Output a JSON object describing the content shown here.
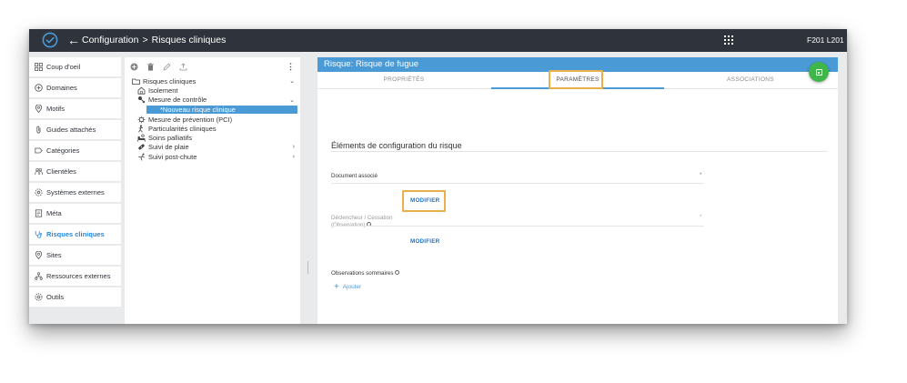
{
  "header": {
    "breadcrumb_root": "Configuration",
    "breadcrumb_separator": ">",
    "breadcrumb_current": "Risques cliniques",
    "user_code": "F201 L201"
  },
  "sidebar": {
    "items": [
      {
        "label": "Coup d'oeil",
        "icon": "dashboard-icon"
      },
      {
        "label": "Domaines",
        "icon": "domain-icon"
      },
      {
        "label": "Motifs",
        "icon": "pin-icon"
      },
      {
        "label": "Guides attachés",
        "icon": "attachment-icon"
      },
      {
        "label": "Catégories",
        "icon": "tag-icon"
      },
      {
        "label": "Clientèles",
        "icon": "people-icon"
      },
      {
        "label": "Systèmes externes",
        "icon": "settings-icon"
      },
      {
        "label": "Méta",
        "icon": "document-icon"
      },
      {
        "label": "Risques cliniques",
        "icon": "stethoscope-icon",
        "active": true
      },
      {
        "label": "Sites",
        "icon": "location-icon"
      },
      {
        "label": "Ressources externes",
        "icon": "network-icon"
      },
      {
        "label": "Outils",
        "icon": "gear-icon"
      }
    ]
  },
  "tree": {
    "root": "Risques cliniques",
    "items": [
      {
        "label": "Isolement",
        "icon": "home-icon"
      },
      {
        "label": "Mesure de contrôle",
        "icon": "control-icon"
      },
      {
        "label": "*Nouveau risque clinique",
        "selected": true
      },
      {
        "label": "Mesure de prévention (PCI)",
        "icon": "virus-icon"
      },
      {
        "label": "Particularités cliniques",
        "icon": "person-icon"
      },
      {
        "label": "Soins palliatifs",
        "icon": "bed-icon"
      },
      {
        "label": "Suivi de plaie",
        "icon": "bandage-icon"
      },
      {
        "label": "Suivi post-chute",
        "icon": "fall-icon"
      }
    ]
  },
  "detail": {
    "title": "Risque: Risque de fugue",
    "tabs": [
      "PROPRIÉTÉS",
      "PARAMÈTRES",
      "ASSOCIATIONS"
    ],
    "active_tab": 1,
    "section_title": "Éléments de configuration du risque",
    "document_label": "Document associé",
    "modify_label": "MODIFIER",
    "trigger_label_1": "Déclencheur / Cessation",
    "trigger_label_2": "(Observation)",
    "observations_label": "Observations sommaires",
    "add_label": "Ajouter",
    "required_mark": "*"
  },
  "colors": {
    "appbar": "#2f333b",
    "accent": "#4a9ad6",
    "save_button": "#3eb649",
    "highlight": "#e8b04a",
    "active_sidebar": "#1e88e5"
  }
}
